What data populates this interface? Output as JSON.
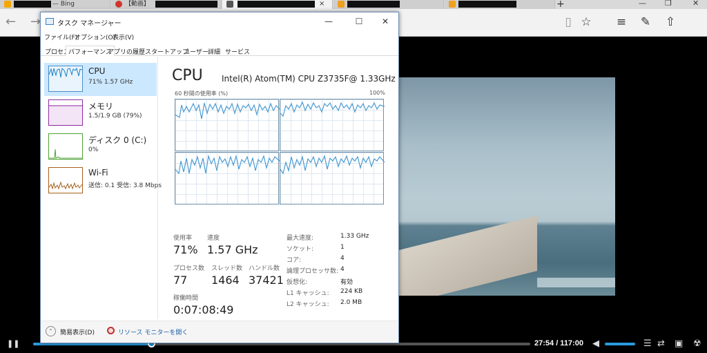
{
  "browser": {
    "tabs": [
      {
        "text": "— Bing",
        "favicon_color": "#f5a700"
      },
      {
        "text": "【動画】",
        "favicon_color": "#d0352b"
      },
      {
        "text": "",
        "favicon_color": "#555555"
      },
      {
        "text": "",
        "favicon_color": "#f0a020"
      },
      {
        "text": "",
        "favicon_color": "#f0a020"
      }
    ],
    "new_tab": "+",
    "close_glyph": "×",
    "nav": {
      "back": "←",
      "forward": "→"
    },
    "toolbar": {
      "reading": "▯",
      "favorite": "☆",
      "hub": "≡",
      "note": "✎",
      "share": "⇧"
    }
  },
  "player": {
    "time": "27:54 / 117:00",
    "progress": 0.238,
    "volume": 1.0,
    "play_pause": "❚❚"
  },
  "task_manager": {
    "title": "タスク マネージャー",
    "window_buttons": {
      "minimize": "—",
      "maximize": "☐",
      "close": "✕"
    },
    "menu": [
      "ファイル(F)",
      "オプション(O)",
      "表示(V)"
    ],
    "tabs": [
      "プロセス",
      "パフォーマンス",
      "アプリの履歴",
      "スタートアップ",
      "ユーザー",
      "詳細",
      "サービス"
    ],
    "active_tab": 1,
    "resources": [
      {
        "name": "CPU",
        "value": "71%  1.57 GHz",
        "color": "#1780c8"
      },
      {
        "name": "メモリ",
        "value": "1.5/1.9 GB (79%)",
        "color": "#8b2aa0"
      },
      {
        "name": "ディスク 0 (C:)",
        "value": "0%",
        "color": "#4da033"
      },
      {
        "name": "Wi-Fi",
        "value": "送信: 0.1  受信: 3.8 Mbps",
        "color": "#a45f19"
      }
    ],
    "detail": {
      "title": "CPU",
      "model": "Intel(R) Atom(TM) CPU Z3735F@ 1.33GHz",
      "graph_caption": "60 秒間の使用率 (%)",
      "graph_max": "100%",
      "stats": {
        "usage_label": "使用率",
        "usage": "71%",
        "speed_label": "速度",
        "speed": "1.57 GHz",
        "processes_label": "プロセス数",
        "processes": "77",
        "threads_label": "スレッド数",
        "threads": "1464",
        "handles_label": "ハンドル数",
        "handles": "37421",
        "uptime_label": "稼働時間",
        "uptime": "0:07:08:49"
      },
      "specs": [
        {
          "k": "最大速度:",
          "v": "1.33 GHz"
        },
        {
          "k": "ソケット:",
          "v": "1"
        },
        {
          "k": "コア:",
          "v": "4"
        },
        {
          "k": "論理プロセッサ数:",
          "v": "4"
        },
        {
          "k": "仮想化:",
          "v": "有効"
        },
        {
          "k": "L1 キャッシュ:",
          "v": "224 KB"
        },
        {
          "k": "L2 キャッシュ:",
          "v": "2.0 MB"
        }
      ]
    },
    "footer": {
      "fewer_details": "簡易表示(D)",
      "resource_monitor": "リソース モニターを開く"
    }
  }
}
